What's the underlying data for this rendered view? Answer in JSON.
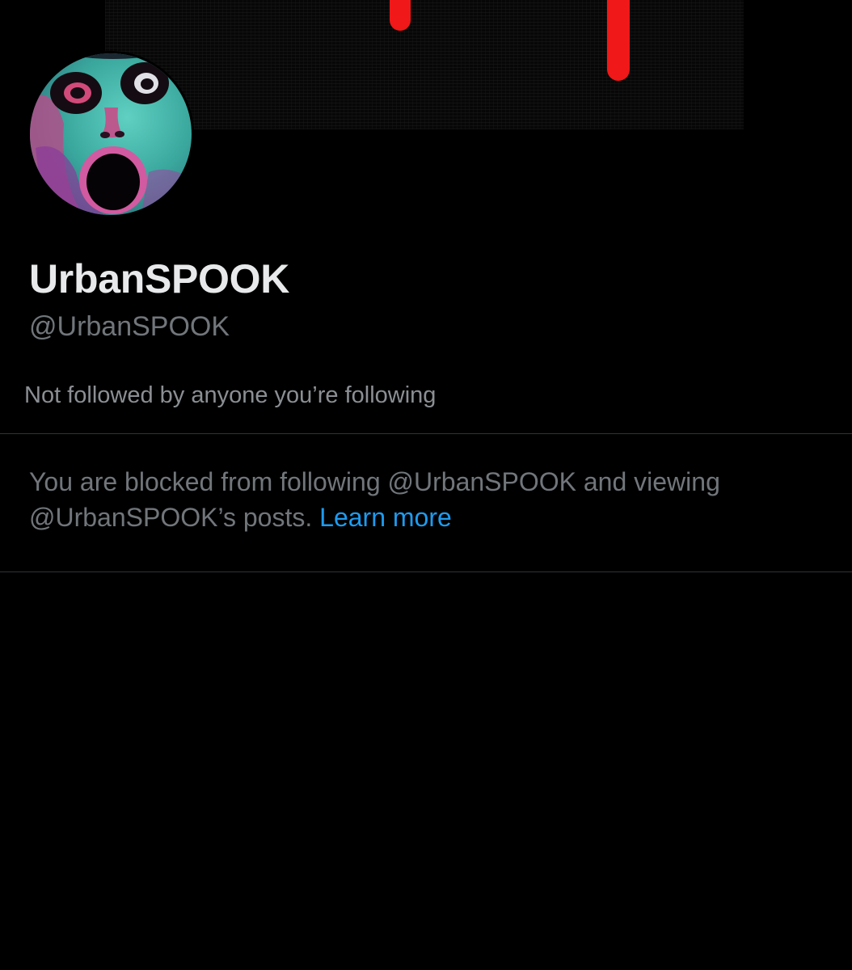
{
  "profile": {
    "display_name": "UrbanSPOOK",
    "handle": "@UrbanSPOOK",
    "followed_by_note": "Not followed by anyone you’re following"
  },
  "blocked": {
    "line1": "You are blocked from following @UrbanSPOOK and viewing",
    "line2": "@UrbanSPOOK’s posts.",
    "learn_more_label": "Learn more"
  },
  "colors": {
    "background": "#000000",
    "primary_text": "#e7e9ea",
    "secondary_text": "#71767b",
    "link": "#1d9bf0",
    "banner_drip": "#f01818"
  }
}
